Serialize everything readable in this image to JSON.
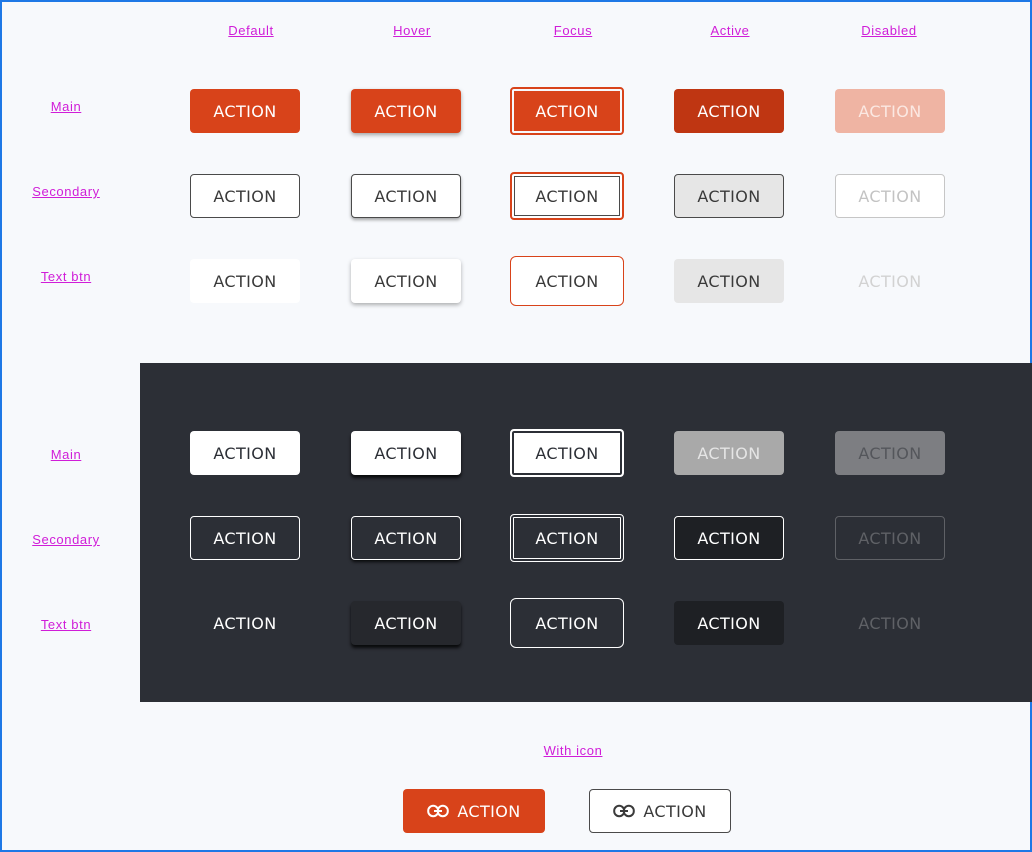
{
  "columns": [
    "Default",
    "Hover",
    "Focus",
    "Active",
    "Disabled"
  ],
  "light_rows": [
    "Main",
    "Secondary",
    "Text btn"
  ],
  "dark_rows": [
    "Main",
    "Secondary",
    "Text btn"
  ],
  "button_label": "ACTION",
  "with_icon": {
    "label": "With icon",
    "main_label": "ACTION",
    "secondary_label": "ACTION",
    "icon": "link-icon"
  },
  "colors": {
    "accent": "#d8431a",
    "accent_active": "#bf3612",
    "accent_disabled": "#efb4a3",
    "dark_panel": "#2c2f36",
    "label": "#d01dd8"
  }
}
